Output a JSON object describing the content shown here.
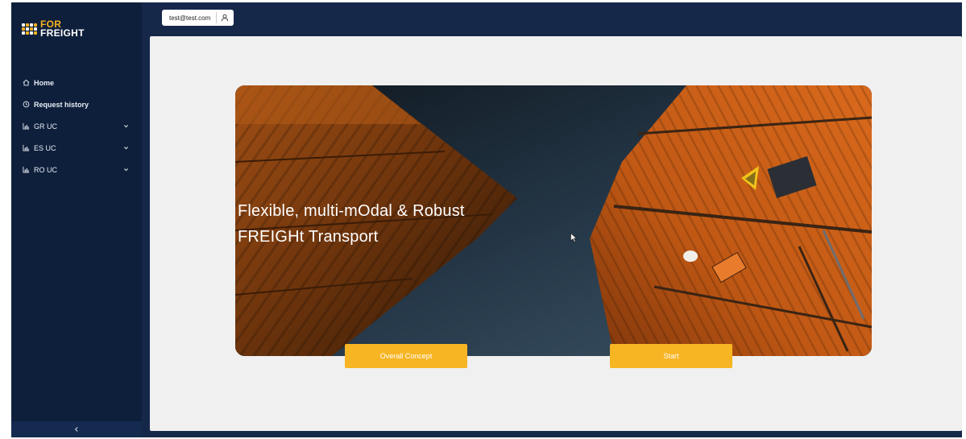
{
  "brand": {
    "logo_top": "FOR",
    "logo_bottom": "FREIGHT",
    "accent": "#f5b21f"
  },
  "sidebar": {
    "items": [
      {
        "label": "Home",
        "icon": "home-icon"
      },
      {
        "label": "Request history",
        "icon": "clock-icon"
      },
      {
        "label": "GR UC",
        "icon": "chart-icon",
        "expandable": true
      },
      {
        "label": "ES UC",
        "icon": "chart-icon",
        "expandable": true
      },
      {
        "label": "RO UC",
        "icon": "chart-icon",
        "expandable": true
      }
    ],
    "collapse_icon": "chevron-left-icon"
  },
  "header": {
    "user_email": "test@test.com",
    "user_icon": "user-icon"
  },
  "hero": {
    "title": "Flexible, multi-mOdal & Robust\nFREIGHt Transport"
  },
  "actions": {
    "overall_concept": "Overall Concept",
    "start": "Start",
    "button_color": "#f7b524"
  },
  "colors": {
    "sidebar_bg": "#0e1f3b",
    "topbar_bg": "#16284a",
    "content_bg": "#f0f0f0"
  }
}
